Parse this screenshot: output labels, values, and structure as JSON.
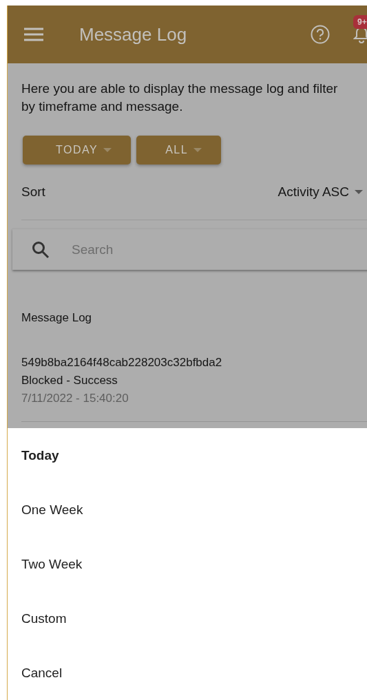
{
  "app_bar": {
    "title": "Message Log",
    "notification_badge": "9+"
  },
  "description": "Here you are able to display the message log and filter by timeframe and message.",
  "filters": [
    {
      "label": "TODAY"
    },
    {
      "label": "ALL"
    }
  ],
  "sort": {
    "label": "Sort",
    "value": "Activity ASC"
  },
  "search": {
    "placeholder": "Search"
  },
  "section_title": "Message Log",
  "messages": [
    {
      "id": "549b8ba2164f48cab228203c32bfbda2",
      "status": "Blocked - Success",
      "time": "7/11/2022 - 15:40:20"
    }
  ],
  "timeframe_menu": {
    "options": [
      {
        "label": "Today",
        "selected": true
      },
      {
        "label": "One Week",
        "selected": false
      },
      {
        "label": "Two Week",
        "selected": false
      },
      {
        "label": "Custom",
        "selected": false
      },
      {
        "label": "Cancel",
        "selected": false
      }
    ]
  }
}
